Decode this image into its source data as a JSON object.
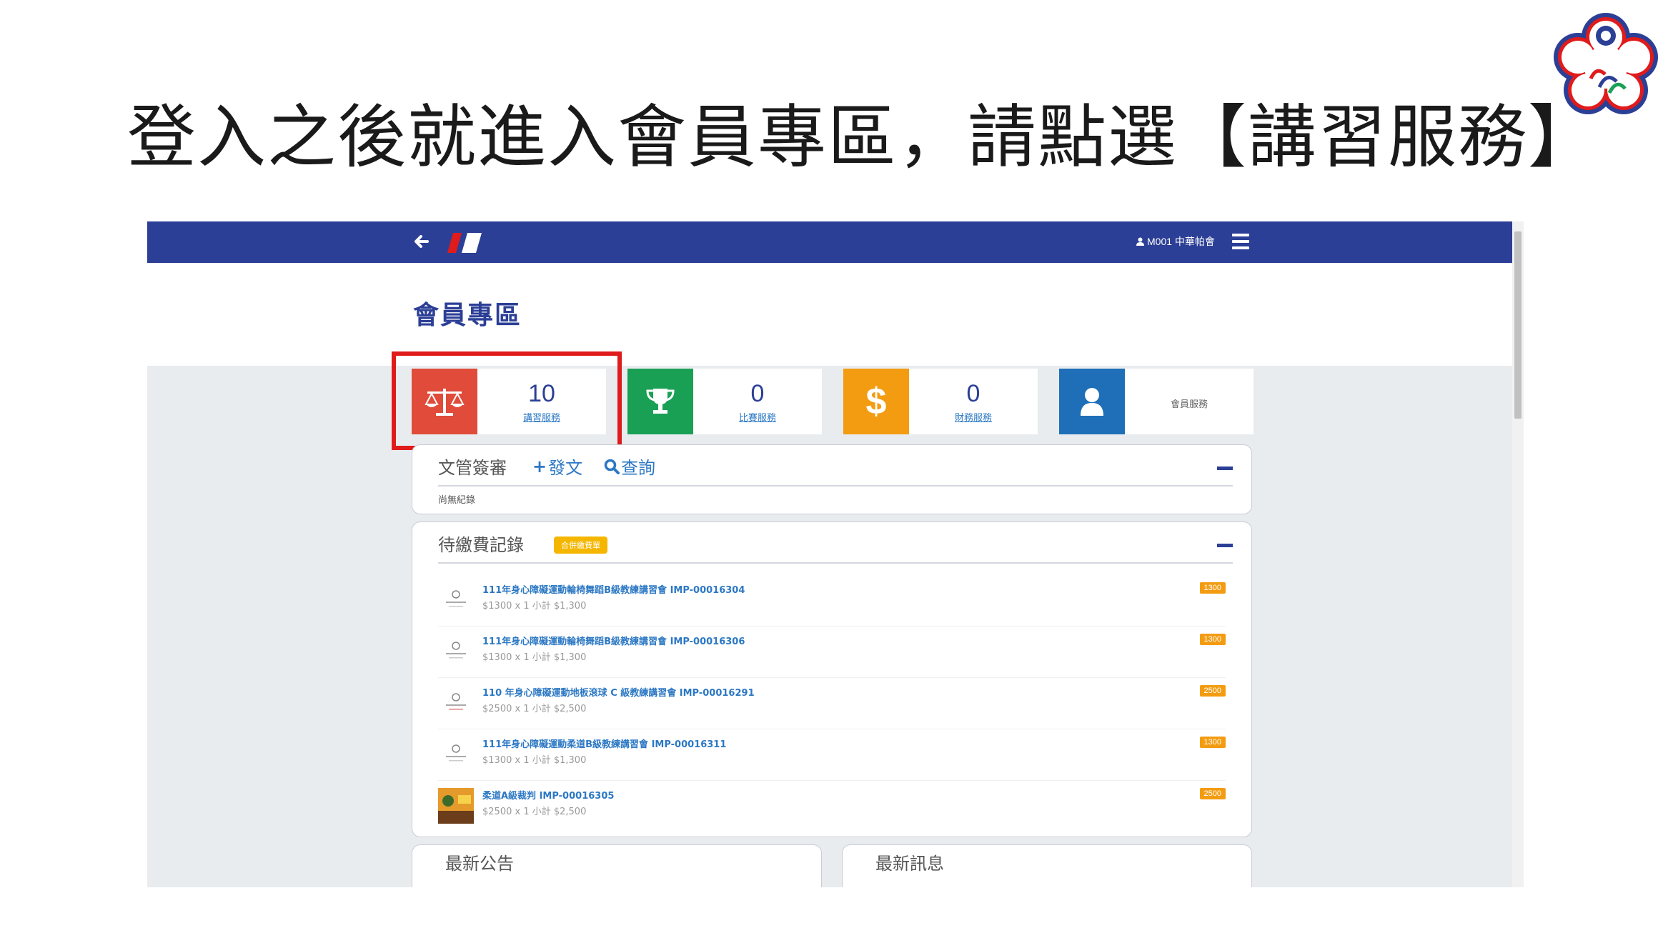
{
  "slide": {
    "title": "登入之後就進入會員專區，請點選【講習服務】"
  },
  "colors": {
    "navbar": "#2c3f96",
    "highlight": "#e01b1b",
    "service_red": "#e04b3a",
    "service_green": "#1aa055",
    "service_orange": "#f39c12",
    "service_blue": "#1f6fb8"
  },
  "navbar": {
    "back_icon": "arrow-left-icon",
    "user_label": "M001 中華帕會",
    "menu_icon": "hamburger-menu-icon"
  },
  "page": {
    "title": "會員專區"
  },
  "stats": [
    {
      "value": "10",
      "label": "講習服務",
      "icon": "balance-scale-icon",
      "color": "#e04b3a"
    },
    {
      "value": "0",
      "label": "比賽服務",
      "icon": "trophy-icon",
      "color": "#1aa055"
    },
    {
      "value": "0",
      "label": "財務服務",
      "icon": "dollar-icon",
      "color": "#f39c12"
    },
    {
      "value": "",
      "label": "會員服務",
      "icon": "user-icon",
      "color": "#1f6fb8"
    }
  ],
  "documents": {
    "title": "文管簽審",
    "add_label": "發文",
    "search_label": "查詢",
    "empty": "尚無紀錄"
  },
  "fees": {
    "title": "待繳費記錄",
    "merge_button": "合併繳費單",
    "items": [
      {
        "title": "111年身心障礙運動輪椅舞蹈B級教練講習會 IMP-00016304",
        "detail": "$1300 x 1 小計 $1,300",
        "price": "1300"
      },
      {
        "title": "111年身心障礙運動輪椅舞蹈B級教練講習會 IMP-00016306",
        "detail": "$1300 x 1 小計 $1,300",
        "price": "1300"
      },
      {
        "title": "110 年身心障礙運動地板滾球 C 級教練講習會 IMP-00016291",
        "detail": "$2500 x 1 小計 $2,500",
        "price": "2500"
      },
      {
        "title": "111年身心障礙運動柔道B級教練講習會 IMP-00016311",
        "detail": "$1300 x 1 小計 $1,300",
        "price": "1300"
      },
      {
        "title": "柔道A級裁判 IMP-00016305",
        "detail": "$2500 x 1 小計 $2,500",
        "price": "2500"
      }
    ]
  },
  "announcements": {
    "title": "最新公告"
  },
  "news": {
    "title": "最新訊息"
  }
}
